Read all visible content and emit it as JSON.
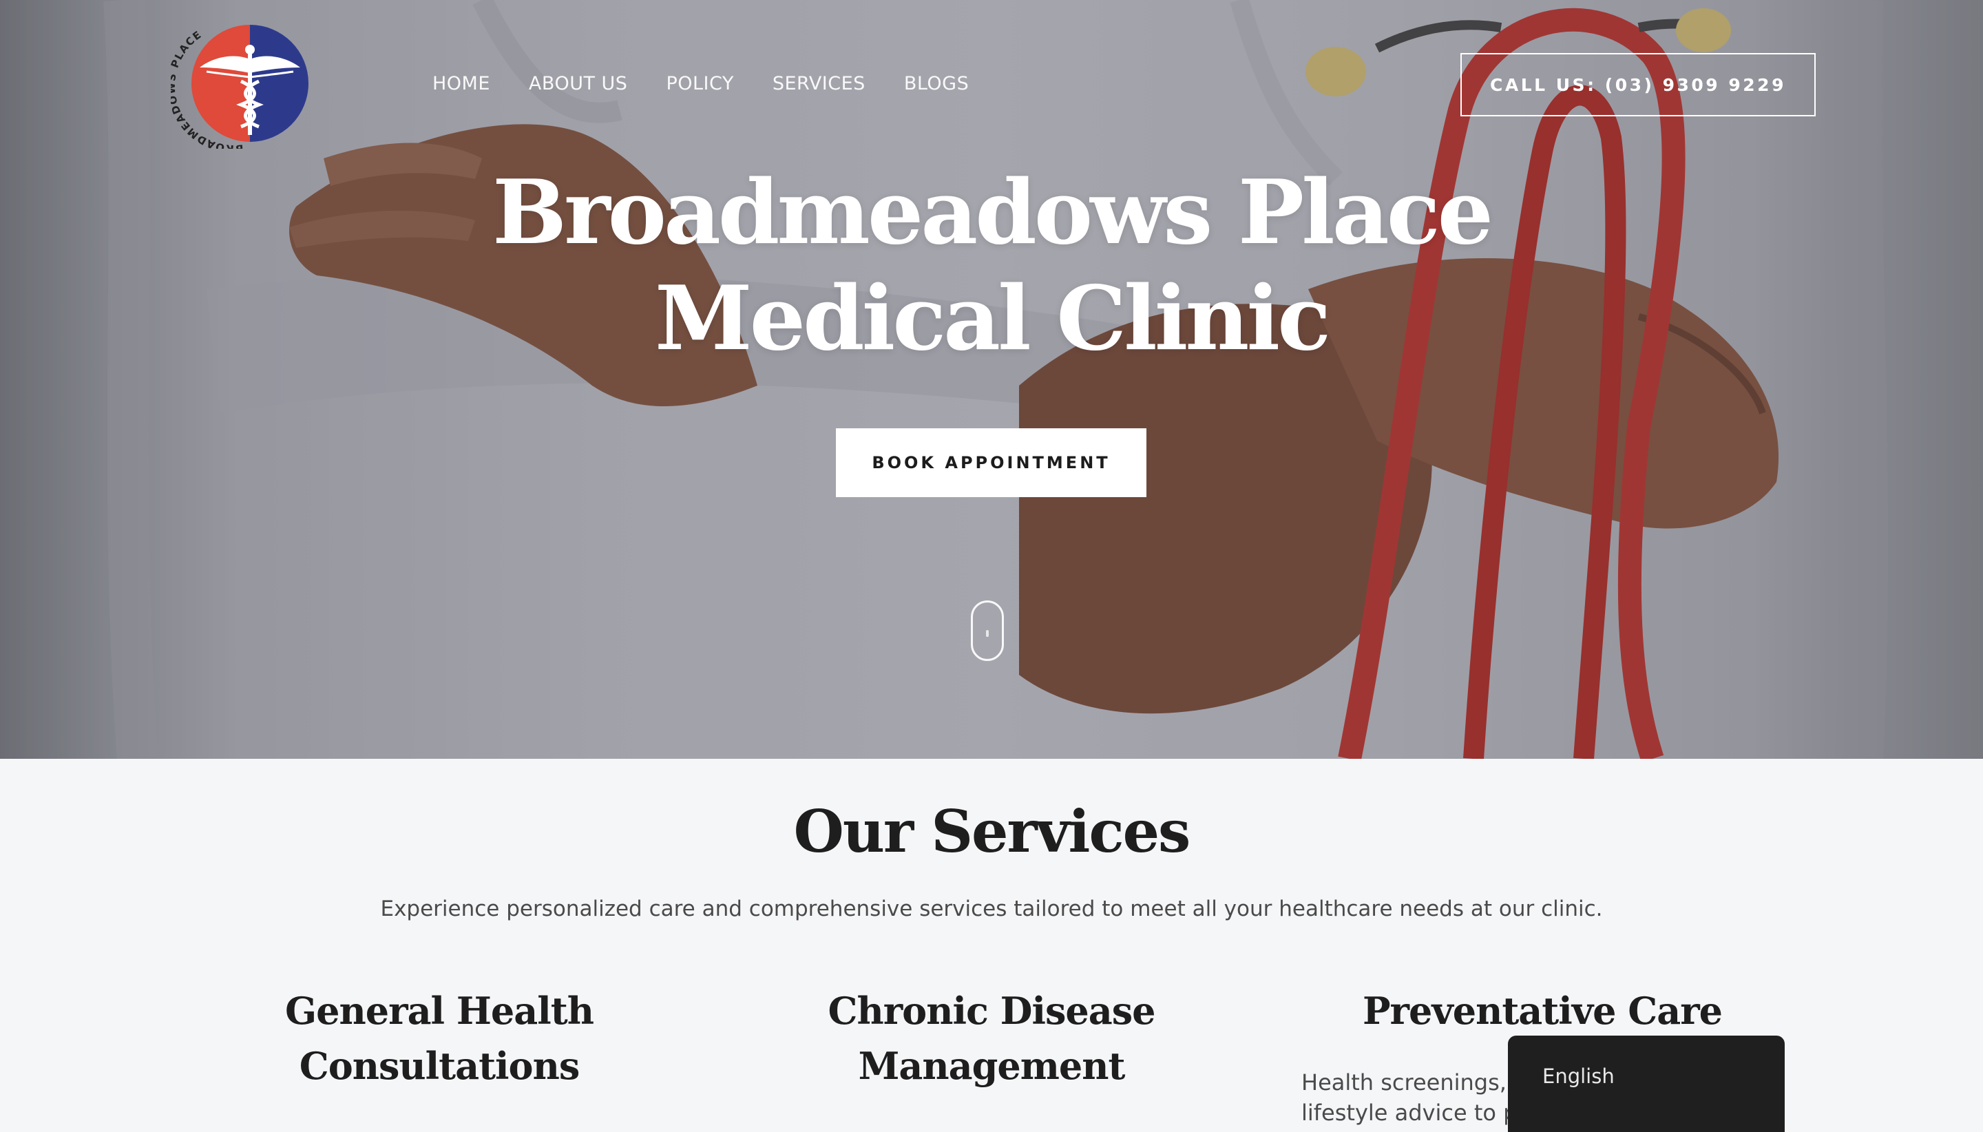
{
  "logo": {
    "ring_text": "BROADMEADOWS PLACE",
    "colors": {
      "left": "#df4a3a",
      "right": "#2d3a8c"
    }
  },
  "nav": {
    "items": [
      {
        "label": "HOME"
      },
      {
        "label": "ABOUT US"
      },
      {
        "label": "POLICY"
      },
      {
        "label": "SERVICES"
      },
      {
        "label": "BLOGS"
      }
    ],
    "call_label": "CALL US: (03) 9309 9229"
  },
  "hero": {
    "title_line1": "Broadmeadows Place",
    "title_line2": "Medical Clinic",
    "cta_label": "BOOK APPOINTMENT"
  },
  "services": {
    "title": "Our Services",
    "subtitle": "Experience personalized care and comprehensive services tailored to meet all your healthcare needs at our clinic.",
    "cards": [
      {
        "title_line1": "General Health",
        "title_line2": "Consultations"
      },
      {
        "title_line1": "Chronic Disease",
        "title_line2": "Management"
      },
      {
        "title_line1": "Preventative Care",
        "description": "Health screenings, immunisations and lifestyle advice to prevent illness."
      }
    ]
  },
  "language_widget": {
    "label": "English"
  },
  "colors": {
    "accent": "#c8322e",
    "dark": "#1e1e1e",
    "page_bg": "#f5f6f8"
  }
}
